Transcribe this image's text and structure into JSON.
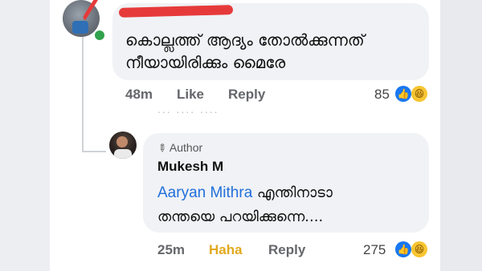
{
  "comment1": {
    "text_line1": "കൊല്ലത്ത് ആദ്യം തോൽക്കുന്നത്",
    "text_line2": "നീയായിരിക്കും മൈരേ",
    "time": "48m",
    "like_label": "Like",
    "reply_label": "Reply",
    "reaction_count": "85",
    "reactions": [
      "like-icon",
      "haha-icon"
    ]
  },
  "ghost_row": "...  ....  ....",
  "reply": {
    "badge": "Author",
    "author": "Mukesh M",
    "mention": "Aaryan Mithra",
    "text_line1_rest": " എന്തിനാടാ",
    "text_line2": "തന്തയെ പറയിക്കുന്നെ....",
    "time": "25m",
    "reaction_label": "Haha",
    "reply_label": "Reply",
    "reaction_count": "275",
    "reactions": [
      "like-icon",
      "haha-icon"
    ]
  },
  "colors": {
    "mention": "#216fdb",
    "haha_active": "#e0a91e",
    "like_blue": "#1877f2",
    "scribble_red": "#e63a3a",
    "online_green": "#31a24c"
  }
}
